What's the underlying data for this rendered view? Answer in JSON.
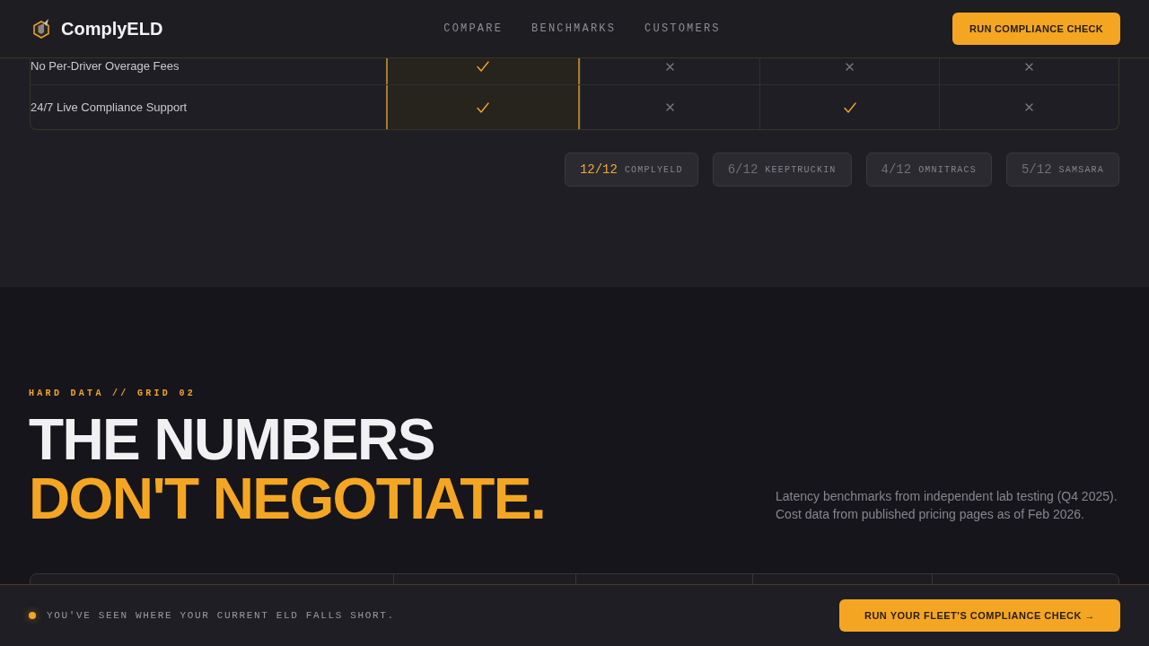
{
  "header": {
    "brand": "ComplyELD",
    "nav": [
      {
        "label": "COMPARE"
      },
      {
        "label": "BENCHMARKS"
      },
      {
        "label": "CUSTOMERS"
      }
    ],
    "cta": "RUN COMPLIANCE CHECK"
  },
  "comparison": {
    "rows": [
      {
        "feature": "No Per-Driver Overage Fees",
        "cells": [
          {
            "kind": "check",
            "highlighted": true
          },
          {
            "kind": "cross",
            "highlighted": false
          },
          {
            "kind": "cross",
            "highlighted": false
          },
          {
            "kind": "cross",
            "highlighted": false
          }
        ]
      },
      {
        "feature": "24/7 Live Compliance Support",
        "cells": [
          {
            "kind": "check",
            "highlighted": true
          },
          {
            "kind": "cross",
            "highlighted": false
          },
          {
            "kind": "check",
            "highlighted": false
          },
          {
            "kind": "cross",
            "highlighted": false
          }
        ]
      }
    ],
    "scores": [
      {
        "score": "12/12",
        "vendor": "COMPLYELD",
        "highlighted": true
      },
      {
        "score": "6/12",
        "vendor": "KEEPTRUCKIN",
        "highlighted": false
      },
      {
        "score": "4/12",
        "vendor": "OMNITRACS",
        "highlighted": false
      },
      {
        "score": "5/12",
        "vendor": "SAMSARA",
        "highlighted": false
      }
    ]
  },
  "data_section": {
    "eyebrow": "HARD DATA // GRID 02",
    "headline": [
      {
        "text": "THE NUMBERS",
        "accent": false
      },
      {
        "text": "DON'T NEGOTIATE.",
        "accent": true
      }
    ],
    "description": "Latency benchmarks from independent lab testing (Q4 2025). Cost data from published pricing pages as of Feb 2026."
  },
  "footer_bar": {
    "message": "YOU'VE SEEN WHERE YOUR CURRENT ELD FALLS SHORT.",
    "cta": "RUN YOUR FLEET'S COMPLIANCE CHECK →"
  }
}
